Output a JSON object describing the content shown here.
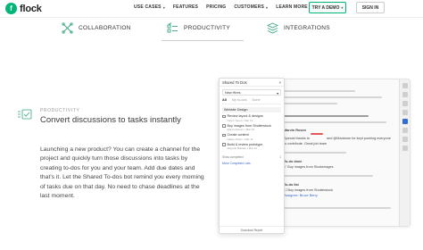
{
  "header": {
    "logo_text": "flock",
    "nav": [
      {
        "label": "USE CASES",
        "has_dropdown": true
      },
      {
        "label": "FEATURES",
        "has_dropdown": false
      },
      {
        "label": "PRICING",
        "has_dropdown": false
      },
      {
        "label": "CUSTOMERS",
        "has_dropdown": true
      },
      {
        "label": "LEARN MORE",
        "has_dropdown": true
      }
    ],
    "demo_button": "TRY A DEMO",
    "signin_button": "SIGN IN",
    "brand_color": "#00b57a"
  },
  "tabs": [
    {
      "label": "COLLABORATION",
      "icon": "collaboration-icon"
    },
    {
      "label": "PRODUCTIVITY",
      "icon": "productivity-icon",
      "active": true
    },
    {
      "label": "INTEGRATIONS",
      "icon": "integrations-icon"
    }
  ],
  "section": {
    "label": "PRODUCTIVITY",
    "heading": "Convert discussions to tasks instantly",
    "description": "Launching a new product? You can create a channel for the project and quickly turn those discussions into tasks by creating to-dos for you and your team. Add due dates and that's it. Let the Shared To-dos bot remind you every morning of tasks due on that day. No need to chase deadlines at the last moment."
  },
  "popup": {
    "title": "Shared To Dos",
    "select_value": "New Hires",
    "tabs": [
      "All",
      "My to-dos",
      "Done"
    ],
    "group": "Website Design",
    "todos": [
      {
        "title": "Review layout & designs",
        "meta": "Karen Jones • Mar 14"
      },
      {
        "title": "Buy images from Shutterstock",
        "meta": "Marvin Rosen • Mar 10"
      },
      {
        "title": "Create content",
        "meta": "Hailey Potter • Mar 11"
      },
      {
        "title": "Build & review prototype",
        "meta": "Mayank Bukhan • Mar 12"
      }
    ],
    "show_completed": "Show completed",
    "show_completed_count": "1",
    "manage_link": "Move Completed Lists",
    "footer": "Download Report"
  },
  "chat_mock": {
    "sender": "Marvin Rosen",
    "mention": "@Marianne",
    "line1": "Special thanks to",
    "line1b": "and @Marianne for kept pushing everyone",
    "line2": "to contribute. Great job team",
    "todo_done_header": "To-do done",
    "todo_done_text": "Buy images from Stockimages",
    "todo_list_header": "To-do list",
    "todo_list_text": "Buy images from Shutterstock",
    "assignee": "Assignee: Bruce Berry"
  }
}
